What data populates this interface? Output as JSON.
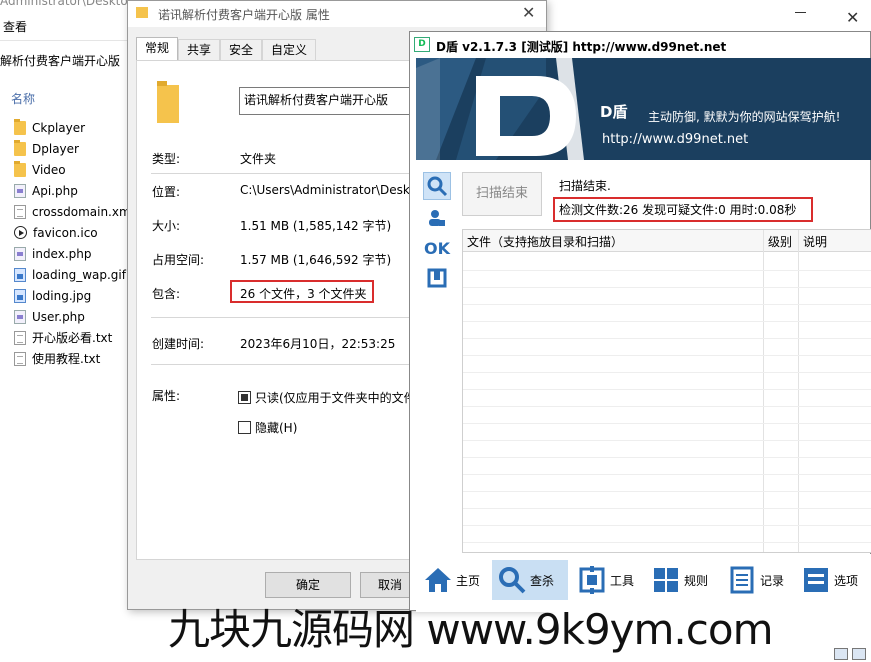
{
  "explorer": {
    "title_partial": "Administrator\\Desktop\\",
    "view_menu": "查看",
    "breadcrumb": "解析付费客户端开心版",
    "column_name": "名称",
    "items": [
      {
        "name": "Ckplayer",
        "icon": "folder-icon"
      },
      {
        "name": "Dplayer",
        "icon": "folder-icon"
      },
      {
        "name": "Video",
        "icon": "folder-icon"
      },
      {
        "name": "Api.php",
        "icon": "php-file-icon"
      },
      {
        "name": "crossdomain.xml",
        "icon": "text-file-icon"
      },
      {
        "name": "favicon.ico",
        "icon": "ico-file-icon"
      },
      {
        "name": "index.php",
        "icon": "php-file-icon"
      },
      {
        "name": "loading_wap.gif",
        "icon": "image-file-icon"
      },
      {
        "name": "loding.jpg",
        "icon": "image-file-icon"
      },
      {
        "name": "User.php",
        "icon": "php-file-icon"
      },
      {
        "name": "开心版必看.txt",
        "icon": "text-file-icon"
      },
      {
        "name": "使用教程.txt",
        "icon": "text-file-icon"
      }
    ]
  },
  "properties": {
    "title": "诺讯解析付费客户端开心版 属性",
    "tabs": [
      "常规",
      "共享",
      "安全",
      "自定义"
    ],
    "folder_name": "诺讯解析付费客户端开心版",
    "type_label": "类型:",
    "type_value": "文件夹",
    "location_label": "位置:",
    "location_value": "C:\\Users\\Administrator\\Desktop",
    "size_label": "大小:",
    "size_value": "1.51 MB (1,585,142 字节)",
    "disk_size_label": "占用空间:",
    "disk_size_value": "1.57 MB (1,646,592 字节)",
    "contains_label": "包含:",
    "contains_value": "26 个文件，3 个文件夹",
    "created_label": "创建时间:",
    "created_value": "2023年6月10日，22:53:25",
    "attributes_label": "属性:",
    "readonly_label": "只读(仅应用于文件夹中的文件)",
    "readonly_checked": true,
    "hidden_label": "隐藏(H)",
    "hidden_checked": false,
    "ok_label": "确定",
    "cancel_label": "取消"
  },
  "dshield": {
    "title": "D盾 v2.1.7.3 [测试版] http://www.d99net.net",
    "logo_text": "D",
    "banner_brand": "D盾",
    "banner_slogan": "主动防御, 默默为你的网站保驾护航!",
    "banner_url": "http://www.d99net.net",
    "side_ok": "OK",
    "scan_button": "扫描结束",
    "scan_status": "扫描结束.",
    "scan_stats": "检测文件数:26 发现可疑文件:0 用时:0.08秒",
    "columns": [
      "文件（支持拖放目录和扫描）",
      "级别",
      "说明"
    ],
    "nav": [
      {
        "label": "主页",
        "icon": "home-icon"
      },
      {
        "label": "查杀",
        "icon": "magnifier-icon"
      },
      {
        "label": "工具",
        "icon": "tools-icon"
      },
      {
        "label": "规则",
        "icon": "rules-icon"
      },
      {
        "label": "记录",
        "icon": "log-icon"
      },
      {
        "label": "选项",
        "icon": "options-icon"
      }
    ],
    "active_nav": "查杀"
  },
  "watermark": "九块九源码网 www.9k9ym.com",
  "colors": {
    "highlight_red": "#d92d2d",
    "banner_bg": "#1b3f5f",
    "accent_blue": "#2a6db5",
    "folder_yellow": "#f5c34c"
  }
}
